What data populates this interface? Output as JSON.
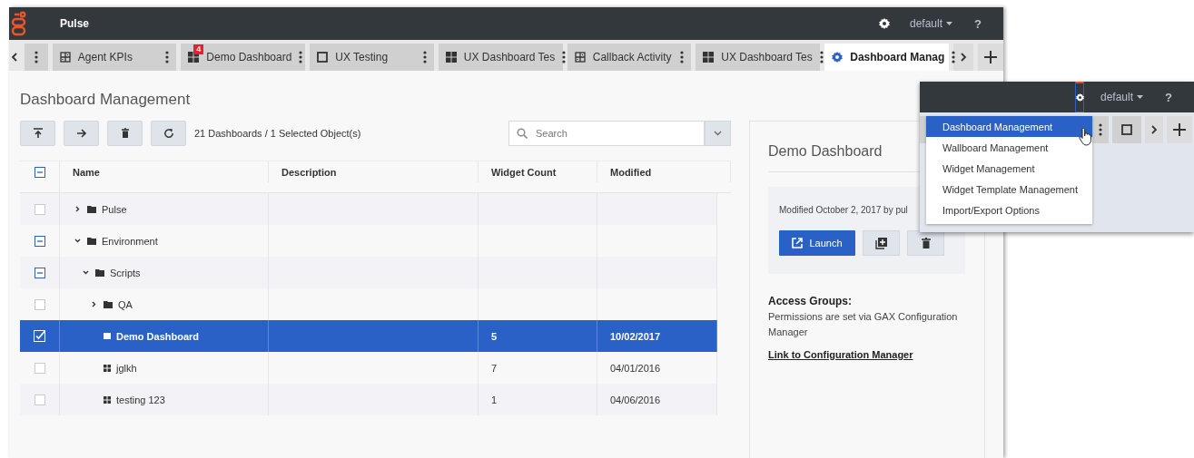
{
  "header": {
    "app_name": "Pulse",
    "user": "default",
    "help": "?"
  },
  "tabs": [
    {
      "kind": "stub",
      "selected": false
    },
    {
      "kind": "kpi",
      "label": "Agent KPIs",
      "selected": false
    },
    {
      "kind": "grid",
      "label": "Demo Dashboard",
      "badge": "4",
      "selected": false
    },
    {
      "kind": "square",
      "label": "UX Testing",
      "selected": false
    },
    {
      "kind": "grid",
      "label": "UX Dashboard Tes",
      "selected": false
    },
    {
      "kind": "kpi",
      "label": "Callback Activity",
      "selected": false
    },
    {
      "kind": "grid",
      "label": "UX Dashboard Tes",
      "selected": false
    },
    {
      "kind": "settings",
      "label": "Dashboard Manag",
      "selected": true
    }
  ],
  "page": {
    "title": "Dashboard Management",
    "summary": "21 Dashboards / 1 Selected Object(s)",
    "search": {
      "placeholder": "Search"
    }
  },
  "table": {
    "checked": false,
    "partial": true,
    "columns": [
      "Name",
      "Description",
      "Widget Count",
      "Modified"
    ],
    "rows": [
      {
        "kind": "folder",
        "name": "Pulse",
        "expanded": false,
        "checked": false,
        "partial": false,
        "selected": false
      },
      {
        "kind": "folder",
        "name": "Environment",
        "expanded": true,
        "checked": false,
        "partial": true,
        "selected": false,
        "children": [
          {
            "kind": "folder",
            "name": "Scripts",
            "expanded": true,
            "checked": false,
            "partial": true,
            "selected": false,
            "children": [
              {
                "kind": "folder",
                "name": "QA",
                "expanded": false,
                "checked": false,
                "partial": false,
                "selected": false
              },
              {
                "kind": "dashboard",
                "name": "Demo Dashboard",
                "checked": true,
                "partial": false,
                "selected": true,
                "widget_count": "5",
                "modified": "10/02/2017"
              },
              {
                "kind": "dashboard",
                "name": "jglkh",
                "checked": false,
                "partial": false,
                "selected": false,
                "widget_count": "7",
                "modified": "04/01/2016"
              },
              {
                "kind": "dashboard",
                "name": "testing 123",
                "checked": false,
                "partial": false,
                "selected": false,
                "widget_count": "1",
                "modified": "04/06/2016"
              }
            ]
          }
        ]
      }
    ]
  },
  "details": {
    "title": "Demo Dashboard",
    "modified": "Modified October 2, 2017 by pul",
    "launch": "Launch",
    "access_heading": "Access Groups:",
    "access_text": "Permissions are set via GAX Configuration Manager",
    "link": "Link to Configuration Manager"
  },
  "inset": {
    "user": "default",
    "help": "?",
    "menu": [
      {
        "label": "Dashboard Management",
        "selected": true
      },
      {
        "label": "Wallboard Management",
        "selected": false
      },
      {
        "label": "Widget Management",
        "selected": false
      },
      {
        "label": "Widget Template Management",
        "selected": false
      },
      {
        "label": "Import/Export Options",
        "selected": false
      }
    ]
  }
}
